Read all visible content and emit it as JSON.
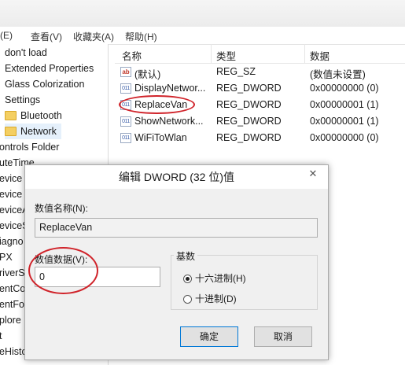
{
  "menu": [
    "(E)",
    "查看(V)",
    "收藏夹(A)",
    "帮助(H)"
  ],
  "tree": {
    "items": [
      "don't load",
      "Extended Properties",
      "Glass Colorization",
      "Settings",
      "Bluetooth",
      "Network",
      "ontrols Folder",
      "uteTime",
      "evice",
      "evice",
      "eviceA",
      "eviceS",
      "iagno",
      "PX",
      "riverS",
      "entCo",
      "entFo",
      "plore",
      "t",
      "eHisto"
    ]
  },
  "list": {
    "headers": [
      "名称",
      "类型",
      "数据"
    ],
    "rows": [
      {
        "icon": "ab",
        "name": "(默认)",
        "type": "REG_SZ",
        "data": "(数值未设置)"
      },
      {
        "icon": "bin",
        "name": "DisplayNetwor...",
        "type": "REG_DWORD",
        "data": "0x00000000 (0)"
      },
      {
        "icon": "bin",
        "name": "ReplaceVan",
        "type": "REG_DWORD",
        "data": "0x00000001 (1)"
      },
      {
        "icon": "bin",
        "name": "ShowNetwork...",
        "type": "REG_DWORD",
        "data": "0x00000001 (1)"
      },
      {
        "icon": "bin",
        "name": "WiFiToWlan",
        "type": "REG_DWORD",
        "data": "0x00000000 (0)"
      }
    ]
  },
  "dialog": {
    "title": "编辑 DWORD (32 位)值",
    "close_icon": "✕",
    "name_label": "数值名称(N):",
    "name_value": "ReplaceVan",
    "data_label": "数值数据(V):",
    "data_value": "0",
    "base_label": "基数",
    "hex_label": "十六进制(H)",
    "dec_label": "十进制(D)",
    "ok": "确定",
    "cancel": "取消"
  },
  "icons": {
    "ab": "ab",
    "bin": "011"
  },
  "colors": {
    "annotation": "#d0232a",
    "selection": "#e5f0fb",
    "default_button_border": "#0078d7"
  }
}
